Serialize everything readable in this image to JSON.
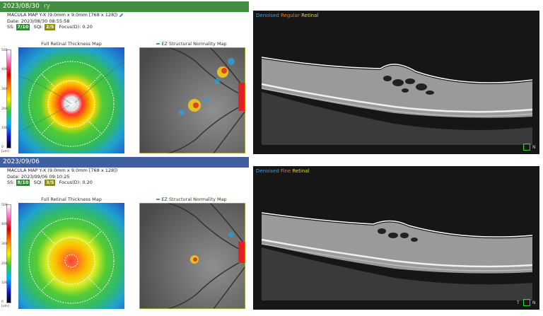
{
  "exams": [
    {
      "date_header": "2023/08/30",
      "date_suffix": "ry",
      "header_color": "#3f8f3f",
      "scan_label": "MACULA MAP Y-X (9.0mm x 9.0mm [768 x 128])",
      "date_line": "Date: 2023/08/30 08:55:58",
      "ss_label": "SS:",
      "ss_value": "7/10",
      "sqi_label": "SQI:",
      "sqi_value": "2/5",
      "focus": "Focus(D): 0.20",
      "thickness_title": "Full Retinal Thickness Map",
      "ez_title": "EZ Structural Normality Map",
      "oct_label_1": "Denoised",
      "oct_label_2": "Regular",
      "oct_label_3": "Retinal",
      "roi_label": "N"
    },
    {
      "date_header": "2023/09/06",
      "date_suffix": "",
      "header_color": "#3f5f9f",
      "scan_label": "MACULA MAP Y-X (9.0mm x 9.0mm [768 x 128])",
      "date_line": "Date: 2023/09/06 09:10:25",
      "ss_label": "SS:",
      "ss_value": "8/10",
      "sqi_label": "SQI:",
      "sqi_value": "3/5",
      "focus": "Focus(D): 0.20",
      "thickness_title": "Full Retinal Thickness Map",
      "ez_title": "EZ Structural Normality Map",
      "oct_label_1": "Denoised",
      "oct_label_2": "Fine",
      "oct_label_3": "Retinal",
      "roi_label": "N",
      "roi_prefix": "T"
    }
  ],
  "scale_ticks": [
    "500",
    "400",
    "300",
    "200",
    "100",
    "0"
  ],
  "scale_unit": "[um]",
  "colors": {
    "green_badge": "#2e8b2e",
    "amber_badge": "#8a8a10",
    "oct_bg": "#161616",
    "roi": "#2bd42b"
  }
}
